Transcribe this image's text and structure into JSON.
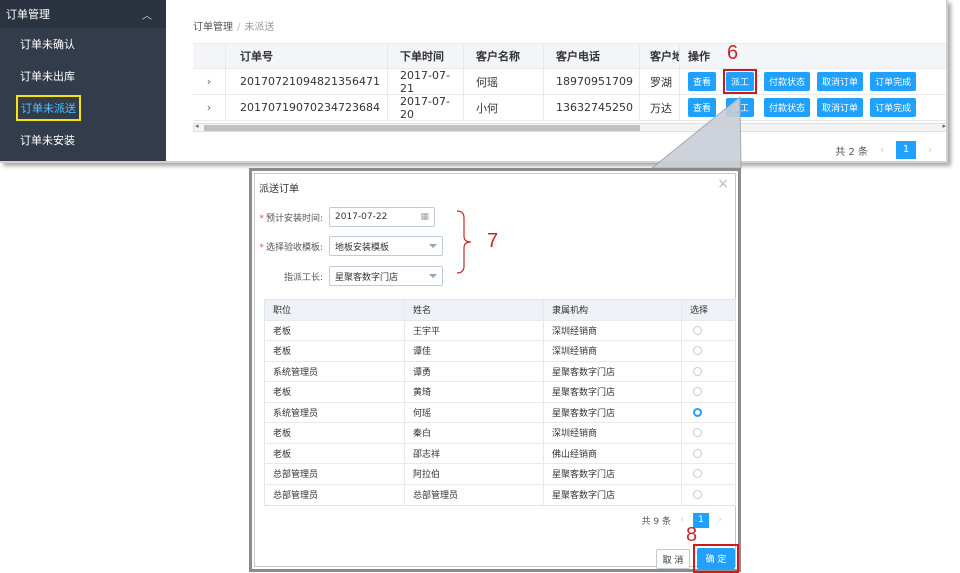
{
  "sidebar": {
    "header": "订单管理",
    "items": [
      {
        "label": "订单未确认"
      },
      {
        "label": "订单未出库"
      },
      {
        "label": "订单未派送"
      },
      {
        "label": "订单未安装"
      }
    ]
  },
  "breadcrumb": {
    "parent": "订单管理",
    "separator": "/",
    "current": "未派送"
  },
  "orders_table": {
    "headers": [
      "订单号",
      "下单时间",
      "客户名称",
      "客户电话",
      "客户地",
      "操作"
    ],
    "rows": [
      {
        "order_no": "20170721094821356471",
        "date": "2017-07-21",
        "name": "何瑶",
        "phone": "18970951709",
        "address": "罗湖"
      },
      {
        "order_no": "20170719070234723684",
        "date": "2017-07-20",
        "name": "小何",
        "phone": "13632745250",
        "address": "万达"
      }
    ],
    "actions": {
      "view": "查看",
      "dispatch": "派工",
      "payment": "付款状态",
      "cancel": "取消订单",
      "complete": "订单完成"
    }
  },
  "pager": {
    "total": "共 2 条",
    "current_page": "1",
    "prev": "‹",
    "next": "›"
  },
  "steps": {
    "s6": "6",
    "s7": "7",
    "s8": "8"
  },
  "dialog": {
    "title": "派送订单",
    "close": "×",
    "form": {
      "install_time_label": "预计安装时间:",
      "install_time_value": "2017-07-22",
      "template_label": "选择验收模板:",
      "template_value": "地板安装模板",
      "foreman_label": "指派工长:",
      "foreman_value": "星聚客数字门店"
    },
    "staff_table": {
      "headers": [
        "职位",
        "姓名",
        "隶属机构",
        "选择"
      ],
      "rows": [
        {
          "position": "老板",
          "name": "王宇平",
          "org": "深圳经销商",
          "selected": false
        },
        {
          "position": "老板",
          "name": "谭佳",
          "org": "深圳经销商",
          "selected": false
        },
        {
          "position": "系统管理员",
          "name": "谭勇",
          "org": "星聚客数字门店",
          "selected": false
        },
        {
          "position": "老板",
          "name": "黄琦",
          "org": "星聚客数字门店",
          "selected": false
        },
        {
          "position": "系统管理员",
          "name": "何瑶",
          "org": "星聚客数字门店",
          "selected": true
        },
        {
          "position": "老板",
          "name": "秦白",
          "org": "深圳经销商",
          "selected": false
        },
        {
          "position": "老板",
          "name": "邵志祥",
          "org": "佛山经销商",
          "selected": false
        },
        {
          "position": "总部管理员",
          "name": "阿拉伯",
          "org": "星聚客数字门店",
          "selected": false
        },
        {
          "position": "总部管理员",
          "name": "总部管理员",
          "org": "星聚客数字门店",
          "selected": false
        }
      ]
    },
    "pager": {
      "total": "共 9 条",
      "current_page": "1",
      "prev": "‹",
      "next": "›"
    },
    "cancel_label": "取 消",
    "confirm_label": "确 定"
  },
  "colors": {
    "primary": "#20a0ff",
    "sidebar_bg": "#333c4a",
    "highlight_yellow": "#f5e50a",
    "annotation_red": "#d01919"
  }
}
